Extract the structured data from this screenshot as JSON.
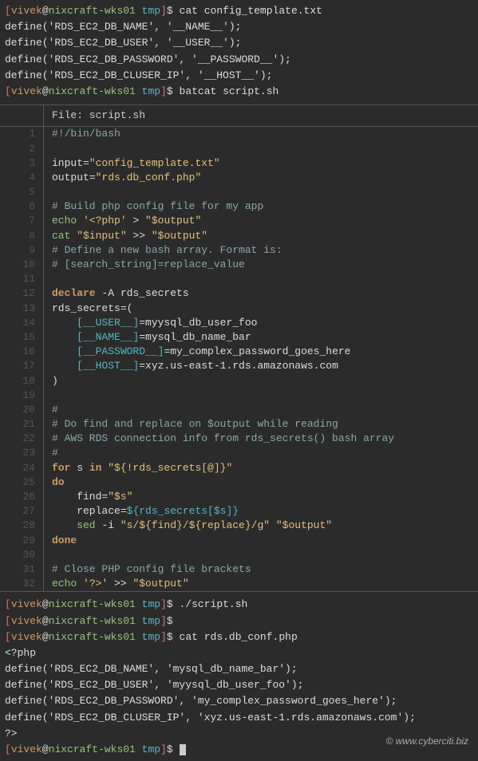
{
  "terminal": {
    "user": "vivek",
    "host": "nixcraft-wks01",
    "dir": "tmp",
    "sep_at": "@",
    "bracket_open": "[",
    "bracket_close": "]",
    "dollar": "$",
    "commands": {
      "cat_config": "cat config_template.txt",
      "batcat": "batcat script.sh",
      "run_script": "./script.sh",
      "empty": "",
      "cat_output": "cat rds.db_conf.php"
    },
    "config_output": {
      "l1": "define('RDS_EC2_DB_NAME', '__NAME__');",
      "l2": "define('RDS_EC2_DB_USER', '__USER__');",
      "l3": "define('RDS_EC2_DB_PASSWORD', '__PASSWORD__');",
      "l4": "define('RDS_EC2_DB_CLUSER_IP', '__HOST__');"
    },
    "php_output": {
      "l1": "<?php",
      "l2": "define('RDS_EC2_DB_NAME', 'mysql_db_name_bar');",
      "l3": "define('RDS_EC2_DB_USER', 'myysql_db_user_foo');",
      "l4": "define('RDS_EC2_DB_PASSWORD', 'my_complex_password_goes_here');",
      "l5": "define('RDS_EC2_DB_CLUSER_IP', 'xyz.us-east-1.rds.amazonaws.com');",
      "l6": "?>"
    }
  },
  "batcat": {
    "file_label": "File: script.sh",
    "lines": {
      "n1": "1",
      "n2": "2",
      "n3": "3",
      "n4": "4",
      "n5": "5",
      "n6": "6",
      "n7": "7",
      "n8": "8",
      "n9": "9",
      "n10": "10",
      "n11": "11",
      "n12": "12",
      "n13": "13",
      "n14": "14",
      "n15": "15",
      "n16": "16",
      "n17": "17",
      "n18": "18",
      "n19": "19",
      "n20": "20",
      "n21": "21",
      "n22": "22",
      "n23": "23",
      "n24": "24",
      "n25": "25",
      "n26": "26",
      "n27": "27",
      "n28": "28",
      "n29": "29",
      "n30": "30",
      "n31": "31",
      "n32": "32"
    }
  },
  "script": {
    "shebang": "#!/bin/bash",
    "input_var": "input",
    "input_eq": "=",
    "input_val": "\"config_template.txt\"",
    "output_var": "output",
    "output_val": "\"rds.db_conf.php\"",
    "comment_build": "# Build php config file for my app",
    "echo1_cmd": "echo",
    "echo1_str": " '<?php'",
    "echo1_redir": " > ",
    "echo1_out": "\"$output\"",
    "cat_cmd": "cat",
    "cat_in": " \"$input\"",
    "cat_redir": " >> ",
    "cat_out": "\"$output\"",
    "comment_define1": "# Define a new bash array. Format is:",
    "comment_define2": "# [search_string]=replace_value",
    "declare_kw": "declare",
    "declare_flag": " -A rds_secrets",
    "rds_assign": "rds_secrets",
    "rds_open": "=(",
    "rds_user_key": "    [__USER__]",
    "rds_user_eq": "=",
    "rds_user_val": "myysql_db_user_foo",
    "rds_name_key": "    [__NAME__]",
    "rds_name_val": "mysql_db_name_bar",
    "rds_pass_key": "    [__PASSWORD__]",
    "rds_pass_val": "my_complex_password_goes_here",
    "rds_host_key": "    [__HOST__]",
    "rds_host_val": "xyz.us-east-1.rds.amazonaws.com",
    "rds_close": ")",
    "comment_hash": "#",
    "comment_do1": "# Do find and replace on $output while reading",
    "comment_do2": "# AWS RDS connection info from rds_secrets() bash array",
    "for_kw": "for",
    "for_var": " s ",
    "in_kw": "in",
    "for_expr": " \"${!rds_secrets[@]}\"",
    "do_kw": "do",
    "find_var": "    find",
    "find_val": "\"$s\"",
    "replace_var": "    replace",
    "replace_val": "${rds_secrets[$s]}",
    "sed_cmd": "    sed",
    "sed_flag": " -i ",
    "sed_expr": "\"s/${find}/${replace}/g\"",
    "sed_sp": " ",
    "sed_out": "\"$output\"",
    "done_kw": "done",
    "comment_close": "# Close PHP config file brackets",
    "echo2_cmd": "echo",
    "echo2_str": " '?>'",
    "echo2_redir": " >> ",
    "echo2_out": "\"$output\""
  },
  "watermark": "© www.cyberciti.biz"
}
